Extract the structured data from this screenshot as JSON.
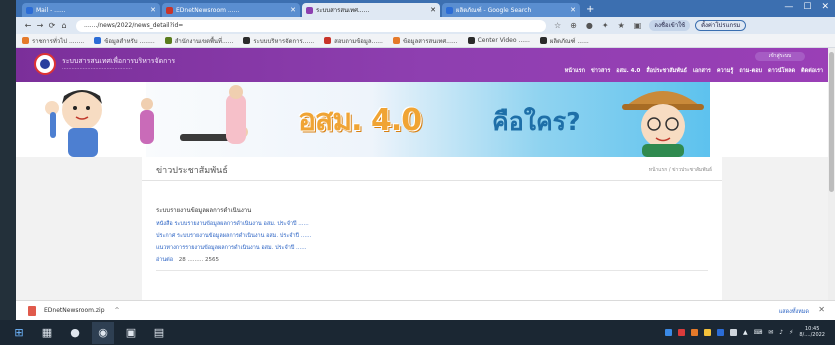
{
  "browser": {
    "tabs": [
      {
        "label": "Mail - ......",
        "active": false,
        "fav_color": "#2b6cd6"
      },
      {
        "label": "EDnetNewsroom ......",
        "active": false,
        "fav_color": "#c8342a"
      },
      {
        "label": "ระบบสารสนเทศ......",
        "active": true,
        "fav_color": "#8c3fb0"
      },
      {
        "label": "ผลิตภัณฑ์ - Google Search",
        "active": false,
        "fav_color": "#2b6cd6"
      }
    ],
    "new_tab": "+",
    "window_controls": {
      "minimize": "—",
      "maximize": "☐",
      "close": "✕"
    },
    "nav": {
      "back": "←",
      "forward": "→",
      "reload": "⟳",
      "home": "⌂"
    },
    "url": "......./news/2022/news_detail?id=",
    "extensions": [
      "☆",
      "⊕",
      "●",
      "✦",
      "★",
      "▣"
    ],
    "profile_label": "ลงชื่อเข้าใช้",
    "update_label": "ตั้งค่าโปรแกรม",
    "bookmarks": [
      {
        "label": "ราชการทั่วไป ........",
        "fav_color": "#e57a2a"
      },
      {
        "label": "ข้อมูลสำหรับ ........",
        "fav_color": "#2b6cd6"
      },
      {
        "label": "สำนักงานเขตพื้นที่......",
        "fav_color": "#5a7c1e"
      },
      {
        "label": "ระบบบริหารจัดการ......",
        "fav_color": "#2b2b2b"
      },
      {
        "label": "สอบถามข้อมูล......",
        "fav_color": "#c8342a"
      },
      {
        "label": "ข้อมูลสารสนเทศ......",
        "fav_color": "#e57a2a"
      },
      {
        "label": "Center Video ......",
        "fav_color": "#2b2b2b"
      },
      {
        "label": "ผลิตภัณฑ์ ......",
        "fav_color": "#2b2b2b"
      }
    ]
  },
  "site": {
    "name": "ระบบสารสนเทศเพื่อการบริหารจัดการ",
    "subtitle": "............................................",
    "top_link": "เข้าสู่ระบบ",
    "nav": [
      "หน้าแรก",
      "ข่าวสาร",
      "อสม. 4.0",
      "สื่อประชาสัมพันธ์",
      "เอกสาร",
      "ความรู้",
      "ถาม-ตอบ",
      "ดาวน์โหลด",
      "ติดต่อเรา"
    ],
    "banner_title": "อสม. 4.0",
    "banner_question": "คือใคร?",
    "page_title": "ข่าวประชาสัมพันธ์",
    "breadcrumb": "หน้าแรก / ข่าวประชาสัมพันธ์",
    "card": {
      "heading": "ระบบรายงานข้อมูลผลการดำเนินงาน",
      "lines": [
        "หนังสือ ระบบรายงานข้อมูลผลการดำเนินงาน อสม. ประจำปี ......",
        "ประกาศ ระบบรายงานข้อมูลผลการดำเนินงาน อสม. ประจำปี ......",
        "แนวทางการรายงานข้อมูลผลการดำเนินงาน อสม. ประจำปี ......"
      ],
      "date_link": "อ่านต่อ",
      "date": "28 ......... 2565"
    }
  },
  "download": {
    "file_name": "EDnetNewsroom.zip",
    "chevron": "^",
    "show_all": "แสดงทั้งหมด",
    "close": "✕"
  },
  "taskbar": {
    "items": [
      {
        "name": "windows-start-icon",
        "glyph": "⊞"
      },
      {
        "name": "file-explorer-icon",
        "glyph": "▦"
      },
      {
        "name": "chat-app-icon",
        "glyph": "●"
      },
      {
        "name": "chrome-icon",
        "glyph": "◉"
      },
      {
        "name": "photos-app-icon",
        "glyph": "▣"
      },
      {
        "name": "terminal-app-icon",
        "glyph": "▤"
      }
    ],
    "tray_glyphs": [
      "▲",
      "⌨",
      "✉",
      "♪",
      "⚡"
    ],
    "tray_colors": [
      "#3b8ae6",
      "#d93b3b",
      "#e57a2a",
      "#f3c13b",
      "#2b6cd6",
      "#cfd6dd"
    ],
    "time": "10:45",
    "date": "8/..../2022"
  }
}
